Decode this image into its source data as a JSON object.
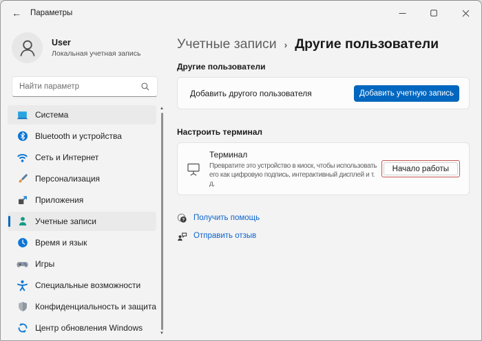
{
  "window": {
    "title": "Параметры",
    "controls": {
      "minimize": "minimize",
      "maximize": "maximize",
      "close": "close"
    }
  },
  "profile": {
    "name": "User",
    "account_type": "Локальная учетная запись"
  },
  "search": {
    "placeholder": "Найти параметр"
  },
  "sidebar": {
    "items": [
      {
        "label": "Система",
        "icon": "system-icon"
      },
      {
        "label": "Bluetooth и устройства",
        "icon": "bluetooth-icon"
      },
      {
        "label": "Сеть и Интернет",
        "icon": "network-icon"
      },
      {
        "label": "Персонализация",
        "icon": "personalization-icon"
      },
      {
        "label": "Приложения",
        "icon": "apps-icon"
      },
      {
        "label": "Учетные записи",
        "icon": "accounts-icon",
        "selected": true
      },
      {
        "label": "Время и язык",
        "icon": "time-language-icon"
      },
      {
        "label": "Игры",
        "icon": "gaming-icon"
      },
      {
        "label": "Специальные возможности",
        "icon": "accessibility-icon"
      },
      {
        "label": "Конфиденциальность и защита",
        "icon": "privacy-icon"
      },
      {
        "label": "Центр обновления Windows",
        "icon": "windows-update-icon"
      }
    ]
  },
  "breadcrumb": {
    "parent": "Учетные записи",
    "separator": "›",
    "current": "Другие пользователи"
  },
  "other_users": {
    "section_label": "Другие пользователи",
    "row_text": "Добавить другого пользователя",
    "button_label": "Добавить учетную запись"
  },
  "kiosk": {
    "section_label": "Настроить терминал",
    "title": "Терминал",
    "description": "Превратите это устройство в киоск, чтобы использовать его как цифровую подпись, интерактивный дисплей и т. д.",
    "button_label": "Начало работы"
  },
  "links": [
    {
      "label": "Получить помощь"
    },
    {
      "label": "Отправить отзыв"
    }
  ],
  "colors": {
    "accent": "#0067c0",
    "link": "#0b63ce",
    "annotation_highlight": "#c55552"
  }
}
